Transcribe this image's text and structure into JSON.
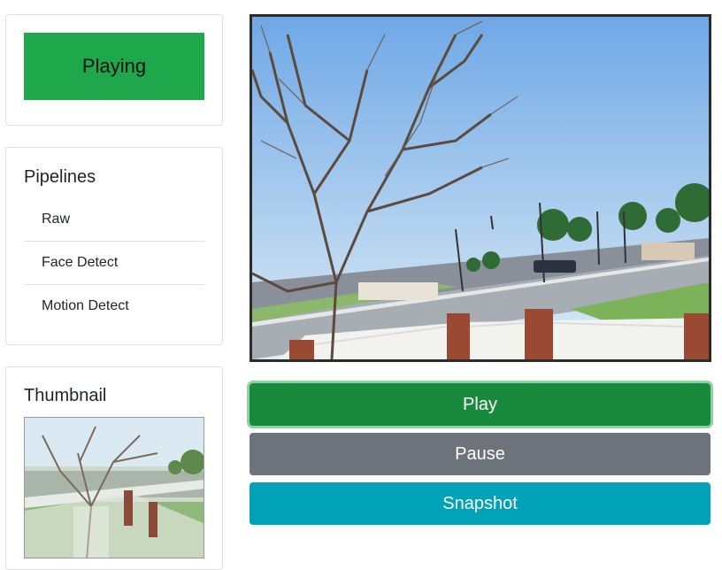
{
  "status": {
    "label": "Playing",
    "color": "#1ea74b"
  },
  "pipelines": {
    "title": "Pipelines",
    "items": [
      {
        "label": "Raw"
      },
      {
        "label": "Face Detect"
      },
      {
        "label": "Motion Detect"
      }
    ]
  },
  "thumbnail": {
    "title": "Thumbnail"
  },
  "controls": {
    "play_label": "Play",
    "pause_label": "Pause",
    "snapshot_label": "Snapshot"
  },
  "colors": {
    "play": "#198a3c",
    "pause": "#6c737a",
    "snapshot": "#00a2b8"
  }
}
